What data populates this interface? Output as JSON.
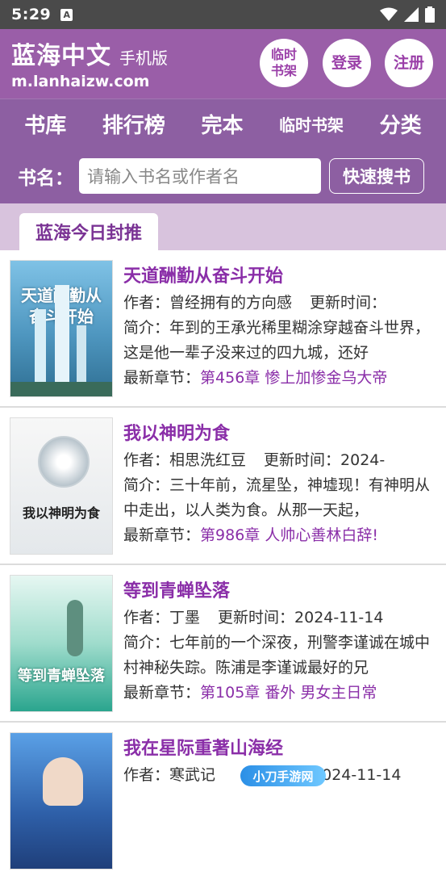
{
  "status_bar": {
    "time": "5:29",
    "notification_letter": "A"
  },
  "header": {
    "site_name": "蓝海中文",
    "site_suffix": "手机版",
    "site_url": "m.lanhaizw.com",
    "buttons": {
      "bookshelf": "临时\n书架",
      "login": "登录",
      "register": "注册"
    }
  },
  "nav": [
    "书库",
    "排行榜",
    "完本",
    "临时书架",
    "分类"
  ],
  "search": {
    "label": "书名：",
    "placeholder": "请输入书名或作者名",
    "button": "快速搜书"
  },
  "section_title": "蓝海今日封推",
  "labels": {
    "author": "作者：",
    "update": "更新时间：",
    "intro": "简介：",
    "latest": "最新章节："
  },
  "books": [
    {
      "title": "天道酬勤从奋斗开始",
      "author": "曾经拥有的方向感",
      "update_time": "",
      "intro": "年到的王承光稀里糊涂穿越奋斗世界，这是他一辈子没来过的四九城，还好",
      "latest_chapter": "第456章 惨上加惨金乌大帝",
      "cover_text": "天道酬勤从奋斗开始",
      "cover_colors": [
        "#6ab0d6",
        "#2f6f93"
      ]
    },
    {
      "title": "我以神明为食",
      "author": "相思洗红豆",
      "update_time": "2024-",
      "intro": "三十年前，流星坠，神墟现！有神明从中走出，以人类为食。从那一天起，",
      "latest_chapter": "第986章 人帅心善林白辞!",
      "cover_text": "我以神明为食",
      "cover_colors": [
        "#f2f2f2",
        "#cfd6dc"
      ]
    },
    {
      "title": "等到青蝉坠落",
      "author": "丁墨",
      "update_time": "2024-11-14",
      "intro": "七年前的一个深夜，刑警李谨诚在城中村神秘失踪。陈浦是李谨诚最好的兄",
      "latest_chapter": "第105章 番外 男女主日常",
      "cover_text": "等到青蝉坠落",
      "cover_colors": [
        "#bfe9e0",
        "#2aa58e"
      ]
    },
    {
      "title": "我在星际重著山海经",
      "author": "寒武记",
      "update_time": "2024-11-14",
      "intro": "",
      "latest_chapter": "",
      "cover_text": "",
      "cover_colors": [
        "#4b8bd6",
        "#1f3f7a"
      ]
    }
  ],
  "watermark": "小刀手游网"
}
